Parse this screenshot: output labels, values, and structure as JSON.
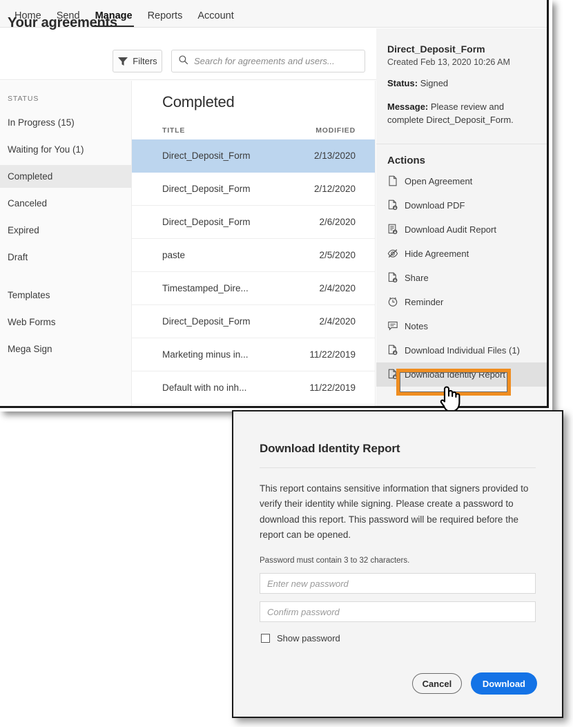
{
  "colors": {
    "accent_blue": "#1473E6",
    "highlight_orange": "#EF8D20",
    "row_selected_blue": "#BCD5EE",
    "panel_gray": "#F4F4F4"
  },
  "topnav": {
    "items": [
      {
        "label": "Home",
        "active": false
      },
      {
        "label": "Send",
        "active": false
      },
      {
        "label": "Manage",
        "active": true
      },
      {
        "label": "Reports",
        "active": false
      },
      {
        "label": "Account",
        "active": false
      }
    ]
  },
  "header": {
    "title": "Your agreements",
    "filters_label": "Filters",
    "filters_icon": "funnel-icon",
    "search_icon": "search-icon",
    "search_placeholder": "Search for agreements and users...",
    "search_value": ""
  },
  "sidebar": {
    "heading": "STATUS",
    "items": [
      {
        "label": "In Progress (15)",
        "selected": false
      },
      {
        "label": "Waiting for You (1)",
        "selected": false
      },
      {
        "label": "Completed",
        "selected": true
      },
      {
        "label": "Canceled",
        "selected": false
      },
      {
        "label": "Expired",
        "selected": false
      },
      {
        "label": "Draft",
        "selected": false
      }
    ],
    "secondary_items": [
      {
        "label": "Templates"
      },
      {
        "label": "Web Forms"
      },
      {
        "label": "Mega Sign"
      }
    ]
  },
  "list": {
    "title": "Completed",
    "columns": {
      "title": "TITLE",
      "modified": "MODIFIED"
    },
    "rows": [
      {
        "title": "Direct_Deposit_Form",
        "modified": "2/13/2020",
        "selected": true
      },
      {
        "title": "Direct_Deposit_Form",
        "modified": "2/12/2020",
        "selected": false
      },
      {
        "title": "Direct_Deposit_Form",
        "modified": "2/6/2020",
        "selected": false
      },
      {
        "title": "paste",
        "modified": "2/5/2020",
        "selected": false
      },
      {
        "title": "Timestamped_Dire...",
        "modified": "2/4/2020",
        "selected": false
      },
      {
        "title": "Direct_Deposit_Form",
        "modified": "2/4/2020",
        "selected": false
      },
      {
        "title": "Marketing minus in...",
        "modified": "11/22/2019",
        "selected": false
      },
      {
        "title": "Default with no inh...",
        "modified": "11/22/2019",
        "selected": false
      }
    ]
  },
  "detail": {
    "title": "Direct_Deposit_Form",
    "created": "Created Feb 13, 2020 10:26 AM",
    "status_label": "Status:",
    "status_value": "Signed",
    "message_label": "Message:",
    "message_value": "Please review and complete Direct_Deposit_Form.",
    "actions_title": "Actions",
    "actions": [
      {
        "label": "Open Agreement",
        "icon": "document-icon",
        "hovered": false
      },
      {
        "label": "Download PDF",
        "icon": "pdf-download-icon",
        "hovered": false
      },
      {
        "label": "Download Audit Report",
        "icon": "audit-report-download-icon",
        "hovered": false
      },
      {
        "label": "Hide Agreement",
        "icon": "eye-slash-icon",
        "hovered": false
      },
      {
        "label": "Share",
        "icon": "share-download-icon",
        "hovered": false
      },
      {
        "label": "Reminder",
        "icon": "clock-alarm-icon",
        "hovered": false
      },
      {
        "label": "Notes",
        "icon": "note-icon",
        "hovered": false
      },
      {
        "label": "Download Individual Files (1)",
        "icon": "file-download-icon",
        "hovered": false
      },
      {
        "label": "Download Identity Report",
        "icon": "file-download-icon",
        "hovered": true
      }
    ]
  },
  "annotation": {
    "highlighted_action": "Download Identity Report",
    "cursor": "pointing-hand-cursor"
  },
  "modal": {
    "title": "Download Identity Report",
    "body": "This report contains sensitive information that signers provided to verify their identity while signing. Please create a password to download this report. This password will be required before the report can be opened.",
    "hint": "Password must contain 3 to 32 characters.",
    "new_password_placeholder": "Enter new password",
    "new_password_value": "",
    "confirm_password_placeholder": "Confirm password",
    "confirm_password_value": "",
    "show_password_label": "Show password",
    "show_password_checked": false,
    "cancel_label": "Cancel",
    "download_label": "Download"
  }
}
